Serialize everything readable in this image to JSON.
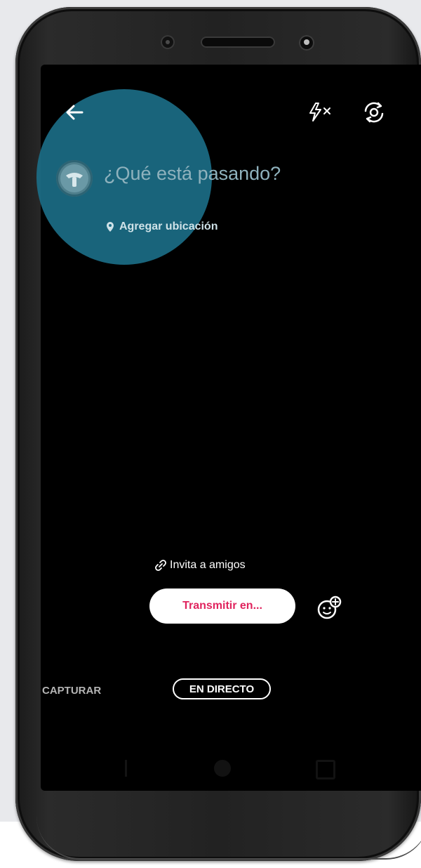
{
  "compose": {
    "prompt_placeholder": "¿Qué está pasando?",
    "location_label": "Agregar ubicación"
  },
  "top_bar": {
    "icons": [
      "arrow-left-icon",
      "flash-off-icon",
      "switch-camera-icon"
    ]
  },
  "invite": {
    "label": "Invita a amigos",
    "icon": "link-icon"
  },
  "broadcast": {
    "button_label": "Transmitir en...",
    "guest_icon": "add-guest-icon"
  },
  "modes": {
    "capture_label": "CAPTURAR",
    "live_label": "EN DIRECTO",
    "selected": "EN DIRECTO"
  },
  "colors": {
    "highlight": "#1b6d86",
    "accent_pink": "#e0245e",
    "screen_bg": "#000000"
  }
}
